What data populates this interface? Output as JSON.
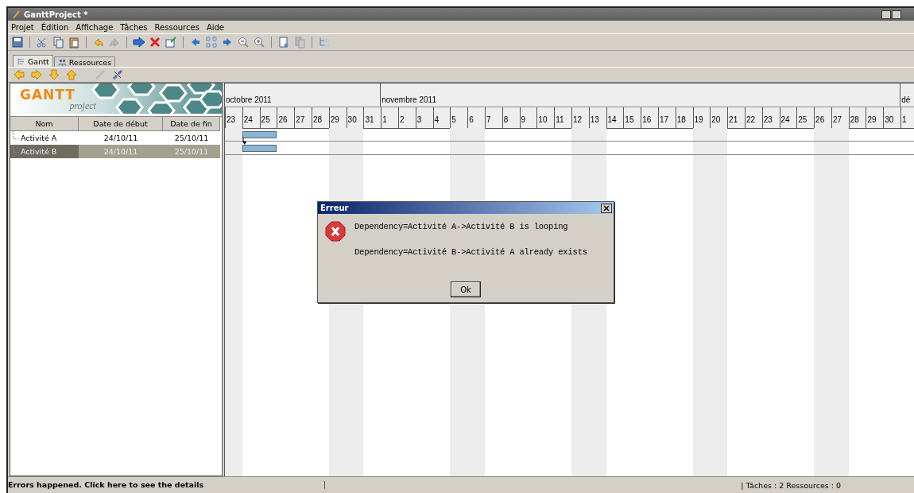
{
  "window": {
    "title": "GanttProject *"
  },
  "menu": [
    "Projet",
    "Édition",
    "Affichage",
    "Tâches",
    "Ressources",
    "Aide"
  ],
  "tabs": [
    {
      "label": "Gantt",
      "selected": true
    },
    {
      "label": "Ressources",
      "selected": false
    }
  ],
  "logo": {
    "title": "GANTT",
    "subtitle": "project"
  },
  "table": {
    "columns": [
      "Nom",
      "Date de début",
      "Date de fin"
    ],
    "rows": [
      {
        "name": "Activité A",
        "start": "24/10/11",
        "end": "25/10/11",
        "selected": false
      },
      {
        "name": "Activité B",
        "start": "24/10/11",
        "end": "25/10/11",
        "selected": true
      }
    ]
  },
  "timeline": {
    "months": [
      {
        "label": "octobre 2011",
        "days": [
          {
            "day": "23",
            "weekend": true
          },
          {
            "day": "24",
            "weekend": false
          },
          {
            "day": "25",
            "weekend": false
          },
          {
            "day": "26",
            "weekend": false
          },
          {
            "day": "27",
            "weekend": false
          },
          {
            "day": "28",
            "weekend": false
          },
          {
            "day": "29",
            "weekend": true
          },
          {
            "day": "30",
            "weekend": true
          },
          {
            "day": "31",
            "weekend": false
          }
        ]
      },
      {
        "label": "novembre 2011",
        "days": [
          {
            "day": "1",
            "weekend": false
          },
          {
            "day": "2",
            "weekend": false
          },
          {
            "day": "3",
            "weekend": false
          },
          {
            "day": "4",
            "weekend": false
          },
          {
            "day": "5",
            "weekend": true
          },
          {
            "day": "6",
            "weekend": true
          },
          {
            "day": "7",
            "weekend": false
          },
          {
            "day": "8",
            "weekend": false
          },
          {
            "day": "9",
            "weekend": false
          },
          {
            "day": "10",
            "weekend": false
          },
          {
            "day": "11",
            "weekend": false
          },
          {
            "day": "12",
            "weekend": true
          },
          {
            "day": "13",
            "weekend": true
          },
          {
            "day": "14",
            "weekend": false
          },
          {
            "day": "15",
            "weekend": false
          },
          {
            "day": "16",
            "weekend": false
          },
          {
            "day": "17",
            "weekend": false
          },
          {
            "day": "18",
            "weekend": false
          },
          {
            "day": "19",
            "weekend": true
          },
          {
            "day": "20",
            "weekend": true
          },
          {
            "day": "21",
            "weekend": false
          },
          {
            "day": "22",
            "weekend": false
          },
          {
            "day": "23",
            "weekend": false
          },
          {
            "day": "24",
            "weekend": false
          },
          {
            "day": "25",
            "weekend": false
          },
          {
            "day": "26",
            "weekend": true
          },
          {
            "day": "27",
            "weekend": true
          },
          {
            "day": "28",
            "weekend": false
          },
          {
            "day": "29",
            "weekend": false
          },
          {
            "day": "30",
            "weekend": false
          }
        ]
      },
      {
        "label": "dé",
        "days": [
          {
            "day": "1",
            "weekend": false
          }
        ]
      }
    ]
  },
  "dialog": {
    "title": "Erreur",
    "messages": [
      "Dependency=Activité A->Activité B is looping",
      "Dependency=Activité B->Activité A already exists"
    ],
    "button": "Ok"
  },
  "status_bar": {
    "message": "Errors happened. Click here to see the details",
    "counts": "| Tâches : 2  Ressources : 0"
  }
}
